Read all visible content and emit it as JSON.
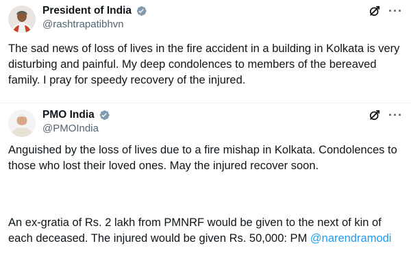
{
  "tweets": [
    {
      "name": "President of India",
      "handle": "@rashtrapatibhvn",
      "avatar_icon": "person-avatar-saree",
      "verified_icon": "government-verified-badge",
      "text": "The sad news of loss of lives in the fire accident in a building in Kolkata is very disturbing and painful. My deep condolences to members of the bereaved family. I pray for speedy recovery of the injured."
    },
    {
      "name": "PMO India",
      "handle": "@PMOIndia",
      "avatar_icon": "person-avatar-white-beard",
      "verified_icon": "government-verified-badge",
      "text_p1": "Anguished by the loss of lives due to a fire mishap in Kolkata. Condolences to those who lost their loved ones. May the injured recover soon.",
      "text_p2": "An ex-gratia of Rs. 2 lakh from PMNRF would be given to the next of kin of each deceased. The injured would be given Rs. 50,000: PM ",
      "mention": "@narendramodi"
    }
  ],
  "icons": {
    "grok": "grok-icon",
    "more": "more-options-icon",
    "more_glyph": "···"
  },
  "colors": {
    "text": "#0f1419",
    "secondary": "#536471",
    "link": "#1d9bf0",
    "verified_badge": "#829aab"
  }
}
